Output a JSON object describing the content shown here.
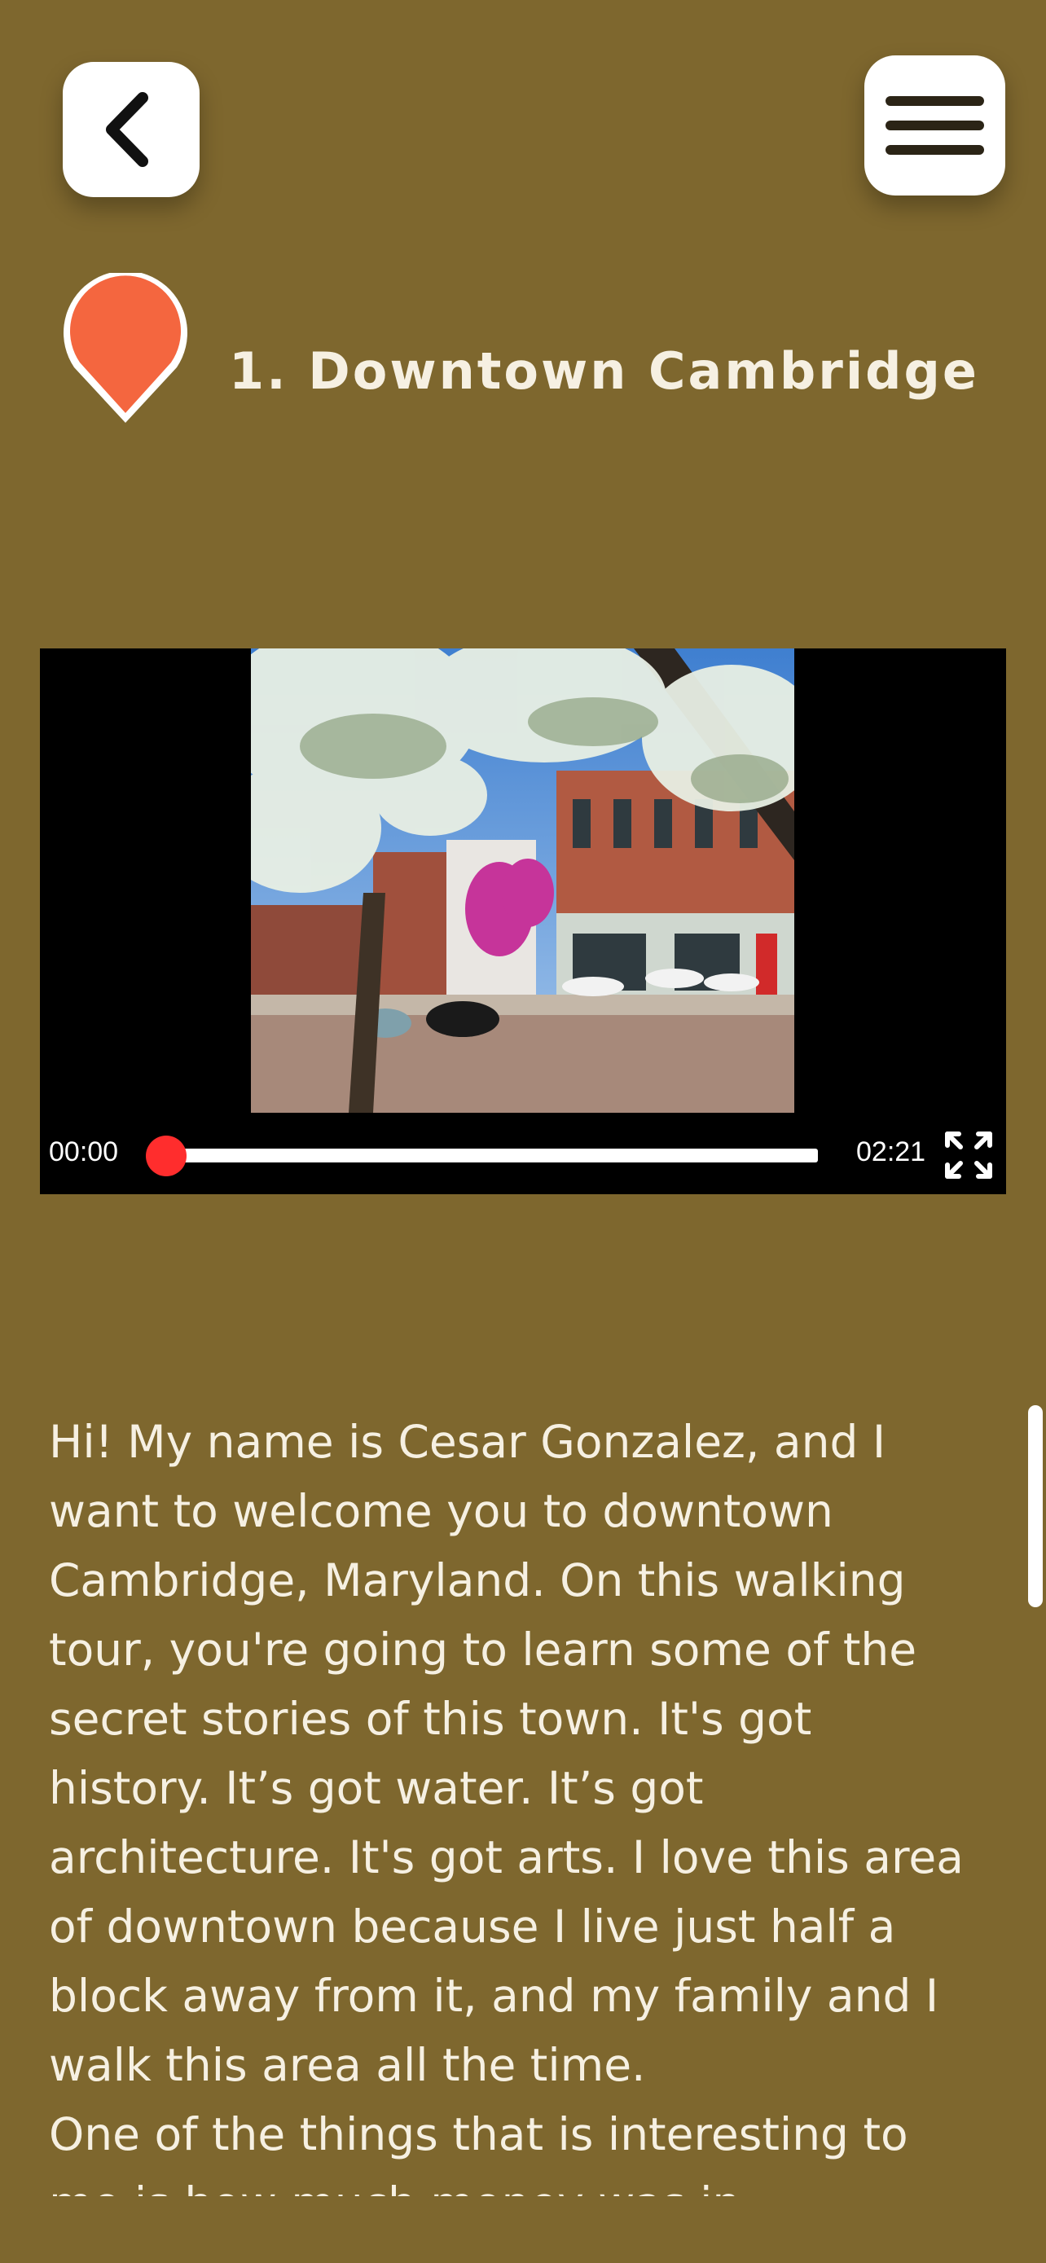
{
  "header": {
    "back_icon": "chevron-left-icon",
    "menu_icon": "hamburger-menu-icon"
  },
  "stop": {
    "title": "1. Downtown Cambridge",
    "pin_icon": "map-pin-icon",
    "pin_color": "#f4663f"
  },
  "video": {
    "current_time": "00:00",
    "total_time": "02:21",
    "progress": 0,
    "progress_color": "#ff2d2d",
    "fullscreen_icon": "fullscreen-icon"
  },
  "transcript": {
    "paragraphs": [
      "Hi! My name is Cesar Gonzalez, and I want to welcome you to downtown Cambridge, Maryland. On this walking tour, you're going to learn some of the secret stories of this town. It's got history. It’s got water. It’s got architecture. It's got arts. I love this area of downtown because I live just half a block away from it, and my family and I walk this area all the time.",
      "One of the things that is interesting to me is how much money was in"
    ]
  },
  "colors": {
    "background": "#7e672e",
    "text": "#f6f0e2"
  }
}
